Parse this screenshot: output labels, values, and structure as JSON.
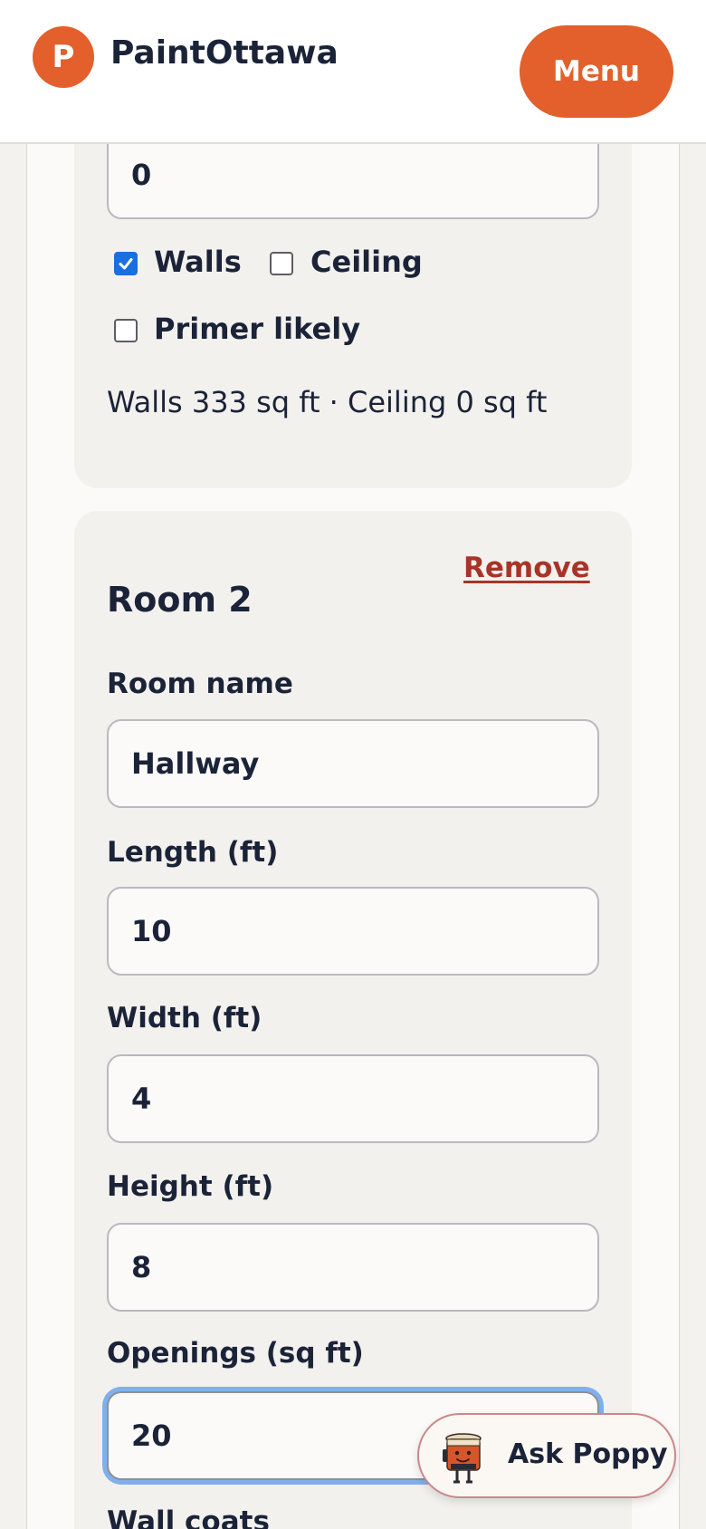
{
  "header": {
    "logo_letter": "P",
    "brand": "PaintOttawa",
    "menu_label": "Menu"
  },
  "room1": {
    "openings_value": "0",
    "walls_label": "Walls",
    "walls_checked": true,
    "ceiling_label": "Ceiling",
    "ceiling_checked": false,
    "primer_label": "Primer likely",
    "primer_checked": false,
    "summary": "Walls 333 sq ft · Ceiling 0 sq ft"
  },
  "room2": {
    "remove_label": "Remove",
    "title": "Room 2",
    "name_label": "Room name",
    "name_value": "Hallway",
    "length_label": "Length (ft)",
    "length_value": "10",
    "width_label": "Width (ft)",
    "width_value": "4",
    "height_label": "Height (ft)",
    "height_value": "8",
    "openings_label": "Openings (sq ft)",
    "openings_value": "20",
    "wall_coats_label": "Wall coats"
  },
  "assistant": {
    "label": "Ask Poppy",
    "icon": "paint-can-mascot-icon"
  },
  "colors": {
    "accent": "#e35f2b",
    "remove": "#a83428",
    "focus_ring": "#7fb0ee",
    "checkbox": "#1a6fe0"
  }
}
